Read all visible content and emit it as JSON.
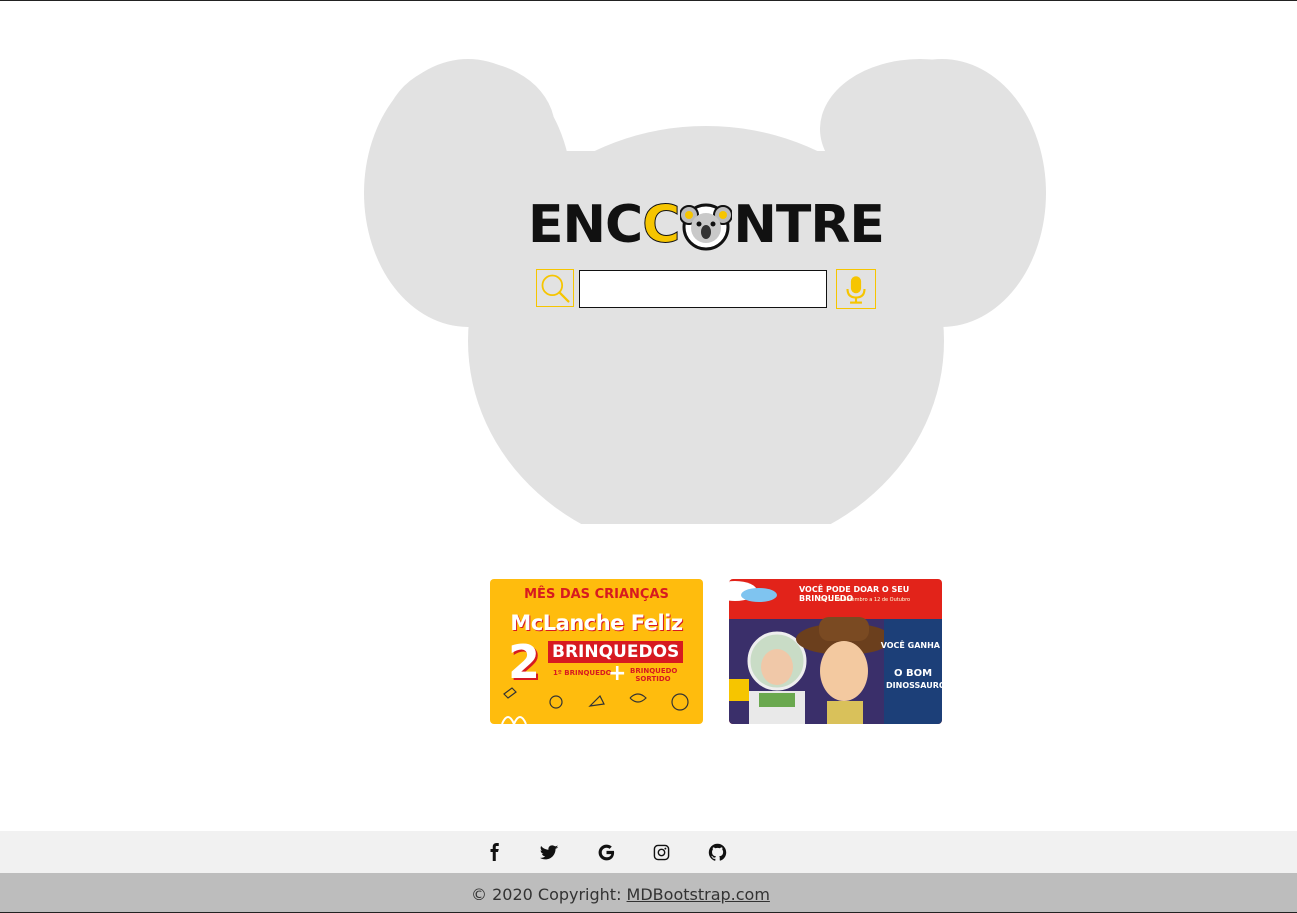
{
  "logo": {
    "part1": "ENC",
    "part2": "C",
    "part3": "NTRE",
    "koala_icon": "koala-icon"
  },
  "search": {
    "value": "",
    "placeholder": "",
    "search_icon": "search-icon",
    "mic_icon": "microphone-icon"
  },
  "banners": [
    {
      "headline": "MÊS DAS CRIANÇAS",
      "brand": "McLanche Feliz",
      "number": "2",
      "toys": "BRINQUEDOS",
      "item1": "1º BRINQUEDO",
      "plus": "+",
      "item2": "BRINQUEDO SORTIDO",
      "bg_color": "#ffbc0d"
    },
    {
      "headline": "VOCÊ PODE DOAR O SEU BRINQUEDO",
      "dates": "De 12 de Setembro a 12 de Outubro",
      "win": "VOCÊ GANHA",
      "movie": "O BOM",
      "movie2": "DINOSSAURO",
      "bg_color": "#e2231a"
    }
  ],
  "footer": {
    "social": [
      {
        "name": "facebook-icon"
      },
      {
        "name": "twitter-icon"
      },
      {
        "name": "google-icon"
      },
      {
        "name": "instagram-icon"
      },
      {
        "name": "github-icon"
      }
    ],
    "copyright_prefix": "© 2020 Copyright: ",
    "copyright_link": "MDBootstrap.com"
  },
  "colors": {
    "accent": "#f6c500",
    "silhouette": "#e2e2e2",
    "footer_top": "#f1f1f1",
    "footer_bottom": "#bdbdbd"
  }
}
